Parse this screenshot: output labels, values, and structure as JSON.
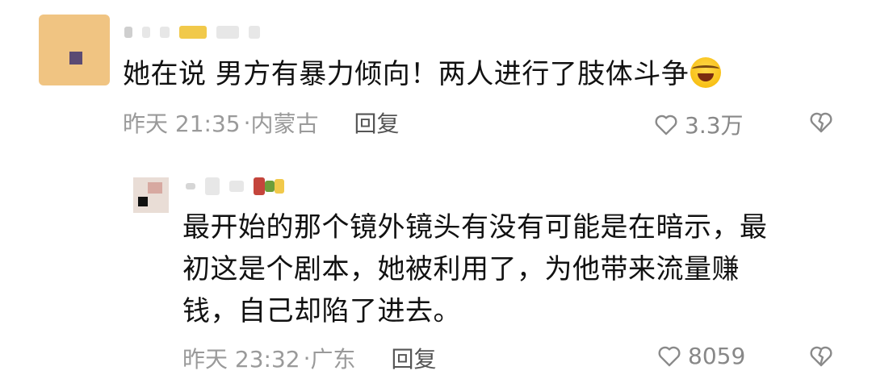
{
  "comments": [
    {
      "text": "她在说 男方有暴力倾向！两人进行了肢体斗争",
      "emoji_icon": "laughing-crying-face-icon",
      "time": "昨天 21:35",
      "separator": "·",
      "location": "内蒙古",
      "reply_label": "回复",
      "likes": "3.3万"
    },
    {
      "text": "最开始的那个镜外镜头有没有可能是在暗示，最\n初这是个剧本，她被利用了，为他带来流量赚\n钱，自己却陷了进去。",
      "time": "昨天 23:32",
      "separator": "·",
      "location": "广东",
      "reply_label": "回复",
      "likes": "8059"
    }
  ],
  "icons": {
    "like": "heart-outline-icon",
    "dislike": "broken-heart-icon"
  },
  "colors": {
    "text": "#111111",
    "meta": "#9a9a9a",
    "icon": "#888888"
  }
}
